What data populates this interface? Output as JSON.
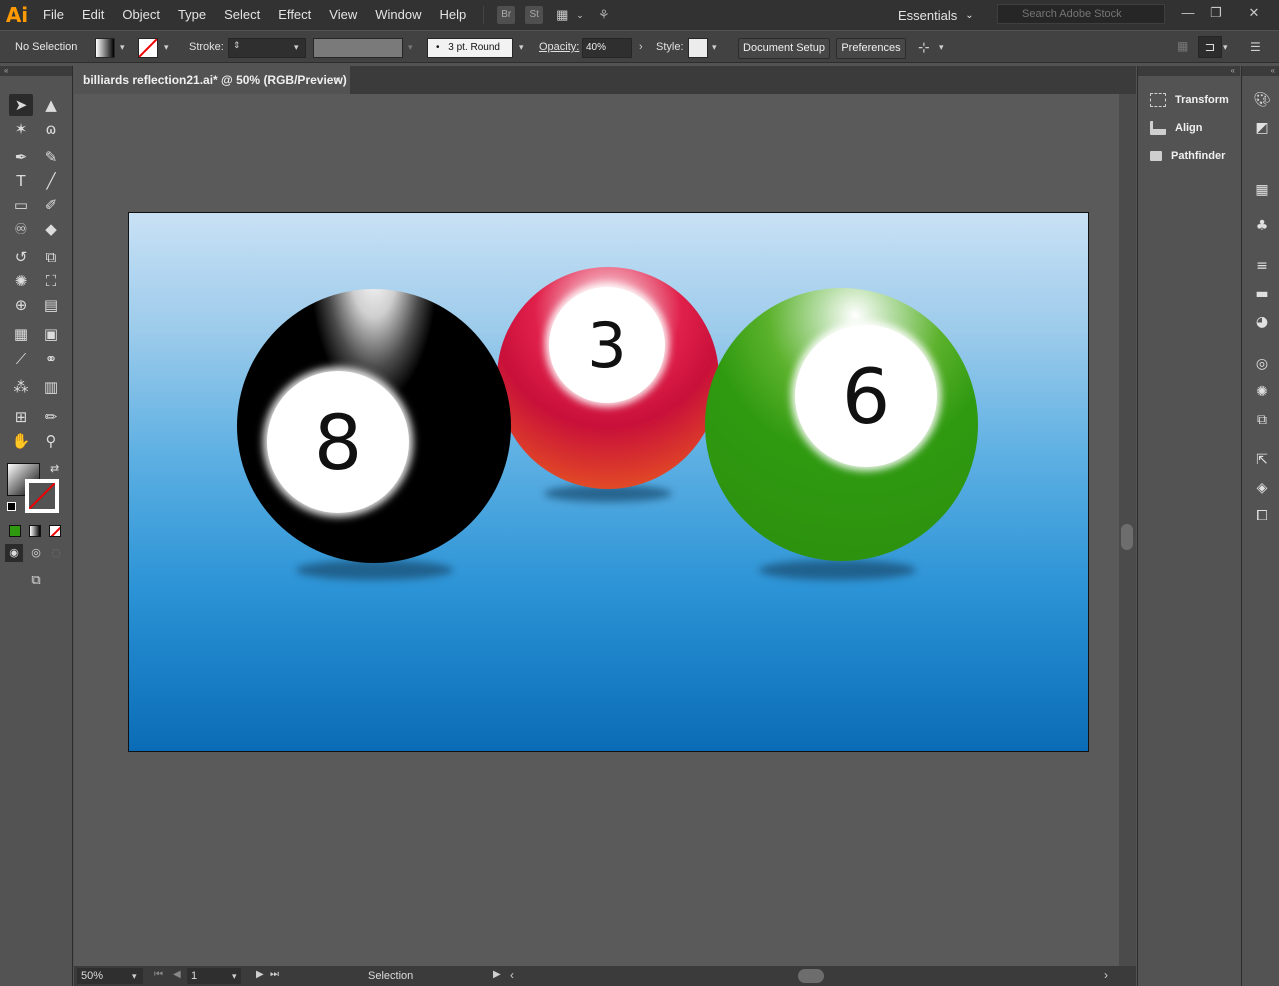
{
  "app": {
    "logo": "Ai"
  },
  "menu": [
    "File",
    "Edit",
    "Object",
    "Type",
    "Select",
    "Effect",
    "View",
    "Window",
    "Help"
  ],
  "menubar_icons": {
    "bridge": "Br",
    "stock": "St"
  },
  "workspace": {
    "label": "Essentials"
  },
  "search": {
    "placeholder": "Search Adobe Stock"
  },
  "control": {
    "selection": "No Selection",
    "stroke_label": "Stroke:",
    "brush": "3 pt. Round",
    "opacity_label": "Opacity:",
    "opacity_value": "40%",
    "style_label": "Style:",
    "document_setup": "Document Setup",
    "preferences": "Preferences"
  },
  "document": {
    "tab_title": "billiards reflection21.ai* @ 50% (RGB/Preview)",
    "close": "×"
  },
  "status": {
    "zoom": "50%",
    "artboard_index": "1",
    "tool": "Selection"
  },
  "right_panel": {
    "items": [
      "Transform",
      "Align",
      "Pathfinder"
    ]
  },
  "artwork": {
    "balls": [
      {
        "number": "8",
        "color": "#000000"
      },
      {
        "number": "3",
        "color": "#d0103a"
      },
      {
        "number": "6",
        "color": "#2f9a10"
      }
    ]
  },
  "colors": {
    "ui_dark": "#323232",
    "canvas": "#5a5a5a",
    "accent": "#ff9a00"
  }
}
